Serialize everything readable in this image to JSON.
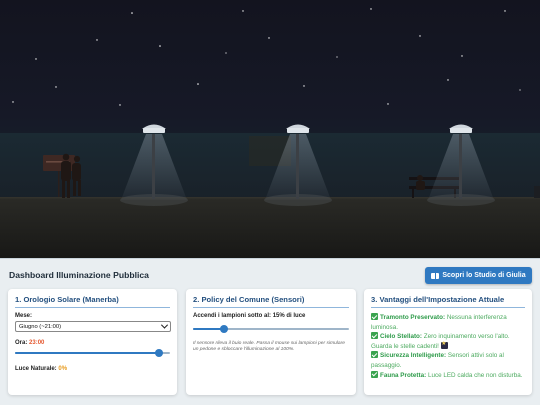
{
  "dashboard": {
    "title": "Dashboard Illuminazione Pubblica",
    "study_button_label": "Scopri lo Studio di Giulia",
    "study_button_icon": "book-icon"
  },
  "solar_clock": {
    "title": "1. Orologio Solare (Manerba)",
    "month_label": "Mese:",
    "month_selected": "Giugno (~21:00)",
    "hour_label": "Ora:",
    "hour_value": "23:00",
    "hour_slider_fraction": 0.93,
    "natural_light_label": "Luce Naturale:",
    "natural_light_value": "0%"
  },
  "policy": {
    "title": "2. Policy del Comune (Sensori)",
    "threshold_label": "Accendi i lampioni sotto al:",
    "threshold_value": "15% di luce",
    "threshold_fraction": 0.2,
    "note": "Il sensore rileva il buio reale. Passa il mouse sui lampioni per simulare un pedone e sbloccare l'illuminazione al 100%."
  },
  "advantages": {
    "title": "3. Vantaggi dell'Impostazione Attuale",
    "items": [
      {
        "title": "Tramonto Preservato:",
        "text": "Nessuna interferenza luminosa."
      },
      {
        "title": "Cielo Stellato:",
        "text": "Zero inquinamento verso l'alto. Guarda le stelle cadenti!"
      },
      {
        "title": "Sicurezza Intelligente:",
        "text": "Sensori attivi solo al passaggio."
      },
      {
        "title": "Fauna Protetta:",
        "text": "Luce LED calda che non disturba."
      }
    ]
  },
  "colors": {
    "accent": "#2f79c1",
    "success": "#2e9b4a",
    "warning": "#e4572e",
    "sky": "#13141f"
  }
}
